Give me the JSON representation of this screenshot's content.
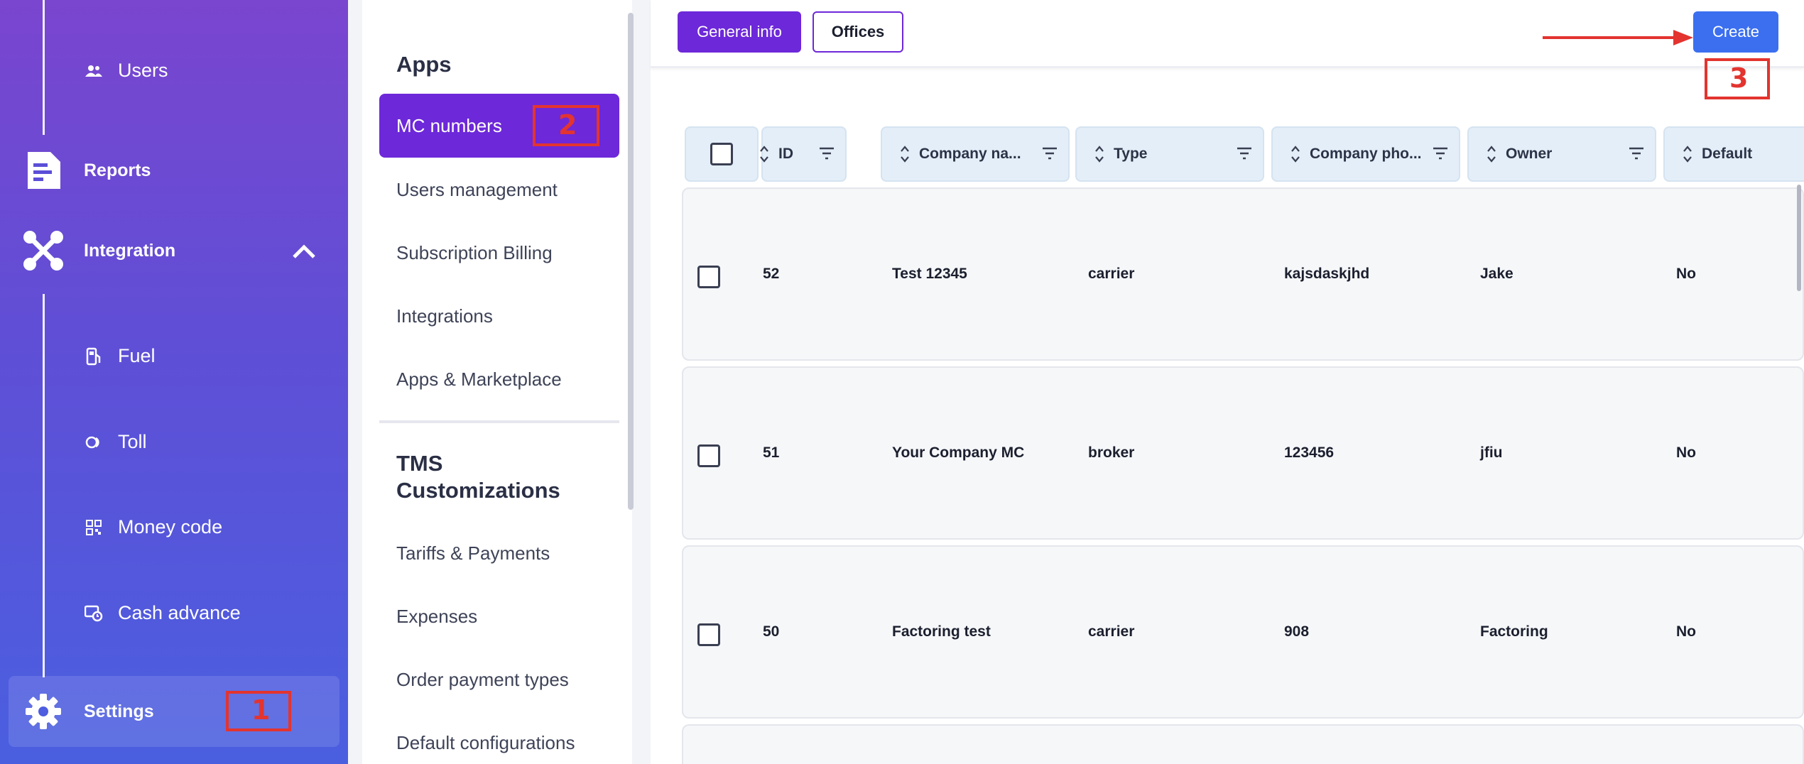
{
  "sidebar": {
    "items": [
      {
        "label": "Users",
        "icon": "users-icon"
      },
      {
        "label": "Reports",
        "icon": "reports-icon"
      },
      {
        "label": "Integration",
        "icon": "integration-icon"
      },
      {
        "label": "Fuel",
        "icon": "fuel-icon"
      },
      {
        "label": "Toll",
        "icon": "toll-icon"
      },
      {
        "label": "Money code",
        "icon": "money-code-icon"
      },
      {
        "label": "Cash advance",
        "icon": "cash-advance-icon"
      },
      {
        "label": "Settings",
        "icon": "gear-icon"
      }
    ]
  },
  "submenu": {
    "apps_heading": "Apps",
    "apps_items": [
      "MC numbers",
      "Users management",
      "Subscription Billing",
      "Integrations",
      "Apps & Marketplace"
    ],
    "tms_heading": "TMS Customizations",
    "tms_items": [
      "Tariffs & Payments",
      "Expenses",
      "Order payment types",
      "Default configurations"
    ]
  },
  "toolbar": {
    "general_info": "General info",
    "offices": "Offices",
    "create": "Create"
  },
  "annotations": [
    "1",
    "2",
    "3"
  ],
  "table": {
    "columns": [
      "ID",
      "Company na...",
      "Type",
      "Company pho...",
      "Owner",
      "Default"
    ],
    "rows": [
      {
        "id": "52",
        "company": "Test 12345",
        "type": "carrier",
        "phone": "kajsdaskjhd",
        "owner": "Jake",
        "default": "No"
      },
      {
        "id": "51",
        "company": "Your Company MC",
        "type": "broker",
        "phone": "123456",
        "owner": "jfiu",
        "default": "No"
      },
      {
        "id": "50",
        "company": "Factoring test",
        "type": "carrier",
        "phone": "908",
        "owner": "Factoring",
        "default": "No"
      }
    ]
  },
  "colors": {
    "accent_purple": "#6d28d9",
    "create_blue": "#3b6ff0",
    "annotation_red": "#e3342f"
  }
}
